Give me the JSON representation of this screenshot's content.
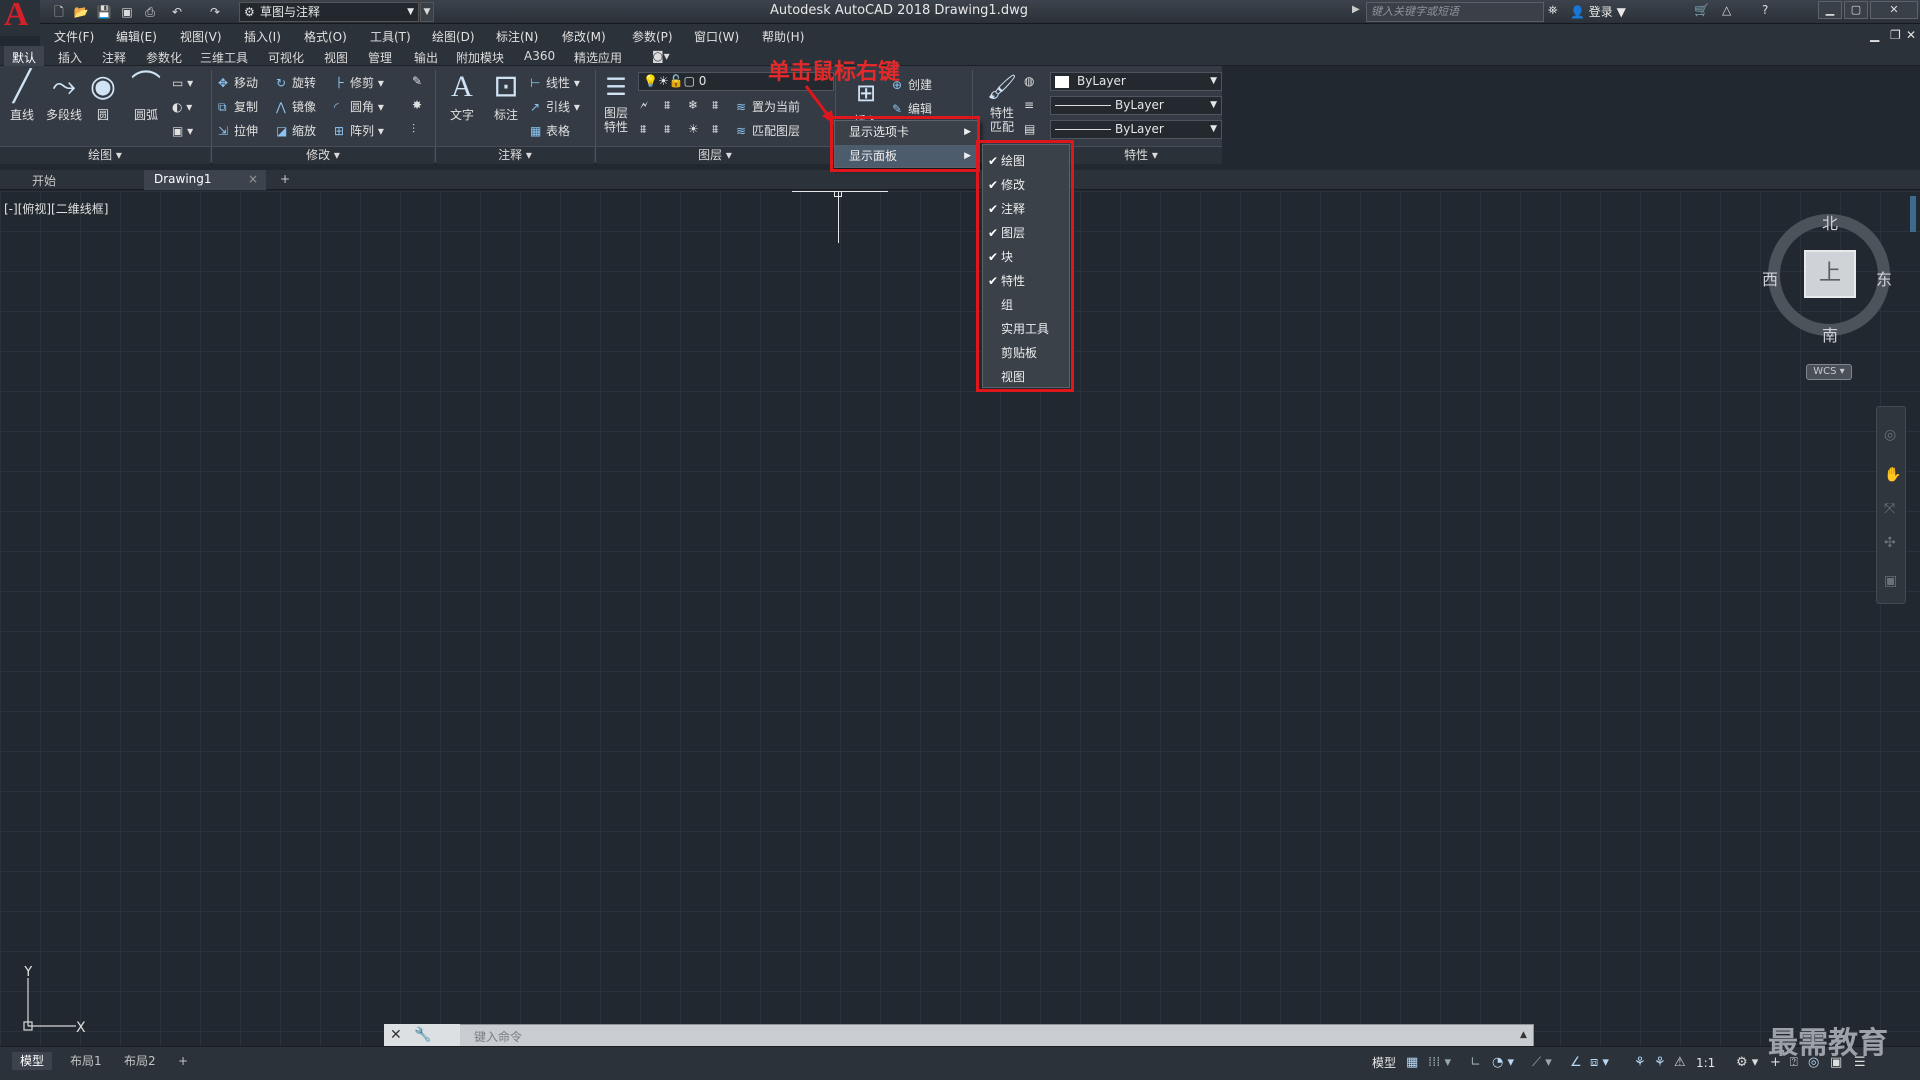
{
  "window": {
    "app_title": "Autodesk AutoCAD 2018    Drawing1.dwg",
    "workspace": "草图与注释",
    "search_placeholder": "键入关键字或短语",
    "login": "登录"
  },
  "menubar": [
    "文件(F)",
    "编辑(E)",
    "视图(V)",
    "插入(I)",
    "格式(O)",
    "工具(T)",
    "绘图(D)",
    "标注(N)",
    "修改(M)",
    "参数(P)",
    "窗口(W)",
    "帮助(H)"
  ],
  "ribbon_tabs": [
    "默认",
    "插入",
    "注释",
    "参数化",
    "三维工具",
    "可视化",
    "视图",
    "管理",
    "输出",
    "附加模块",
    "A360",
    "精选应用"
  ],
  "draw_panel": {
    "line": "直线",
    "polyline": "多段线",
    "circle": "圆",
    "arc": "圆弧",
    "title": "绘图"
  },
  "modify_panel": {
    "move": "移动",
    "rotate": "旋转",
    "trim": "修剪",
    "copy": "复制",
    "mirror": "镜像",
    "fillet": "圆角",
    "stretch": "拉伸",
    "scale": "缩放",
    "array": "阵列",
    "title": "修改"
  },
  "annotation_panel": {
    "text": "文字",
    "dimension": "标注",
    "linear": "线性",
    "leader": "引线",
    "table": "表格",
    "title": "注释"
  },
  "layers_panel": {
    "layer_props": "图层\n特性",
    "current_layer": "0",
    "set_current": "置为当前",
    "match_layer": "匹配图层",
    "title": "图层"
  },
  "block_panel": {
    "insert": "插入",
    "create": "创建",
    "edit": "编辑"
  },
  "properties_panel": {
    "match": "特性\n匹配",
    "color": "ByLayer",
    "linetype": "ByLayer",
    "lineweight": "ByLayer",
    "title": "特性"
  },
  "annotation_callout": "单击鼠标右键",
  "context_menu": {
    "show_tabs": "显示选项卡",
    "show_panels": "显示面板"
  },
  "panels_submenu": [
    {
      "label": "绘图",
      "checked": true
    },
    {
      "label": "修改",
      "checked": true
    },
    {
      "label": "注释",
      "checked": true
    },
    {
      "label": "图层",
      "checked": true
    },
    {
      "label": "块",
      "checked": true
    },
    {
      "label": "特性",
      "checked": true
    },
    {
      "label": "组",
      "checked": false
    },
    {
      "label": "实用工具",
      "checked": false
    },
    {
      "label": "剪贴板",
      "checked": false
    },
    {
      "label": "视图",
      "checked": false
    }
  ],
  "doc_tabs": {
    "start": "开始",
    "drawing": "Drawing1"
  },
  "viewport_label": "[-][俯视][二维线框]",
  "viewcube": {
    "north": "北",
    "south": "南",
    "east": "东",
    "west": "西",
    "face": "上",
    "wcs": "WCS"
  },
  "ucs": {
    "x": "X",
    "y": "Y"
  },
  "command_placeholder": "键入命令",
  "layout_tabs": [
    "模型",
    "布局1",
    "布局2"
  ],
  "status": {
    "model": "模型",
    "scale": "1:1"
  },
  "watermark": "最需教育"
}
